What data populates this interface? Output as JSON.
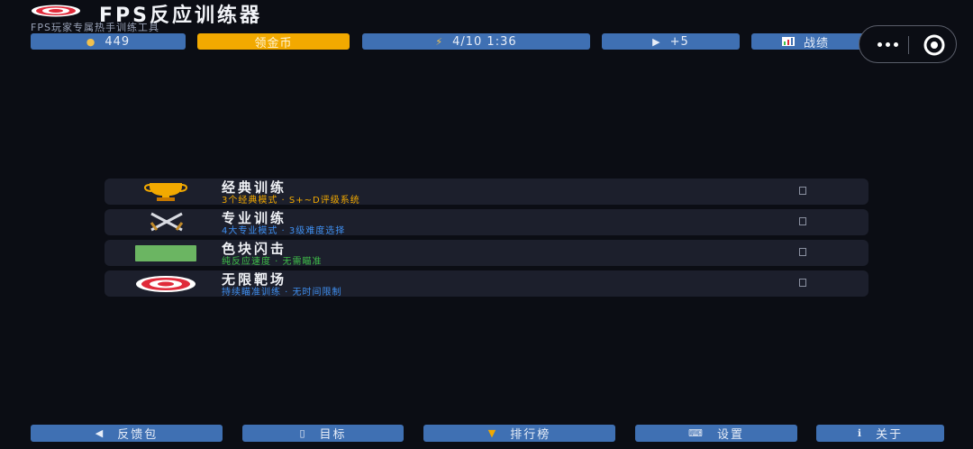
{
  "app": {
    "title": "FPS反应训练器",
    "subtitle": "FPS玩家专属热手训练工具"
  },
  "top_bar": {
    "coins": {
      "icon": "money-bag-icon",
      "value": "449"
    },
    "claim": {
      "label": "领金币"
    },
    "energy": {
      "icon": "lightning-icon",
      "value": "4/10 1:36"
    },
    "video": {
      "icon": "play-icon",
      "value": "+5"
    },
    "stats": {
      "icon": "bar-chart-icon",
      "label": "战绩"
    }
  },
  "capsule": {
    "more_icon": "more-dots-icon",
    "close_icon": "target-circle-icon"
  },
  "modes": [
    {
      "icon": "trophy-icon",
      "title": "经典训练",
      "desc": "3个经典模式 · S+~D评级系统",
      "desc_color": "#f2a900"
    },
    {
      "icon": "crossed-swords-icon",
      "title": "专业训练",
      "desc": "4大专业模式 · 3级难度选择",
      "desc_color": "#3f8ff0"
    },
    {
      "icon": "green-block-icon",
      "title": "色块闪击",
      "desc": "纯反应速度 · 无需瞄准",
      "desc_color": "#3fbf4a"
    },
    {
      "icon": "target-icon",
      "title": "无限靶场",
      "desc": "持续瞄准训练 · 无时间限制",
      "desc_color": "#3f8ff0"
    }
  ],
  "bottom_bar": [
    {
      "icon": "speaker-icon",
      "label": "反馈包"
    },
    {
      "icon": "book-icon",
      "label": "目标"
    },
    {
      "icon": "trophy-icon",
      "label": "排行榜"
    },
    {
      "icon": "keyboard-icon",
      "label": "设置"
    },
    {
      "icon": "info-icon",
      "label": "关于"
    }
  ]
}
